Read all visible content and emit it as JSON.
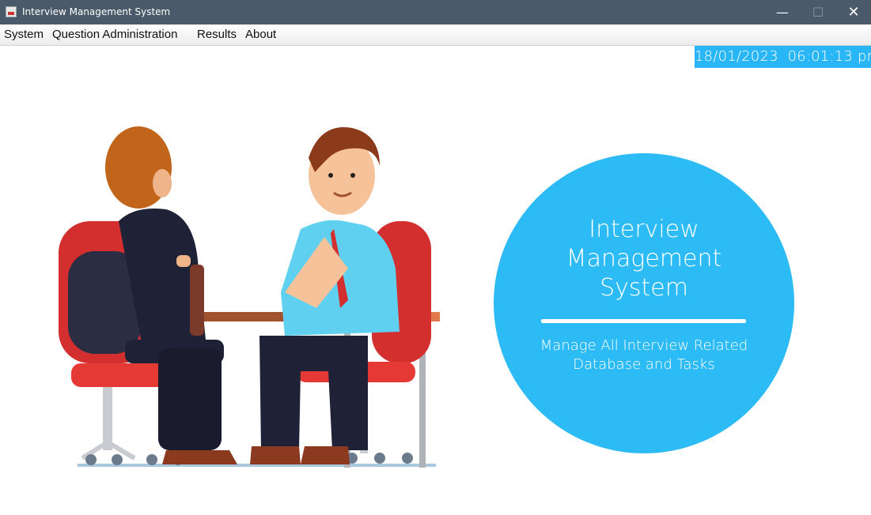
{
  "window": {
    "title": "Interview Management System",
    "controls": {
      "minimize": "—",
      "maximize": "☐",
      "close": "✕"
    }
  },
  "menu": {
    "items": [
      {
        "label": "System"
      },
      {
        "label": "Question Administration"
      },
      {
        "label": "Results"
      },
      {
        "label": "About"
      }
    ]
  },
  "status": {
    "datetime": "18/01/2023  06:01:13 pm"
  },
  "hero": {
    "title_lines": [
      "Interview",
      "Management",
      "System"
    ],
    "subtitle_lines": [
      "Manage All Interview Related",
      "Database and Tasks"
    ]
  },
  "colors": {
    "titlebar": "#4a5a6b",
    "accent": "#2dbbf5",
    "chair": "#e53935",
    "table": "#e07a4a"
  },
  "icons": {
    "app": "java-app-icon",
    "illustration": "interview-illustration"
  }
}
